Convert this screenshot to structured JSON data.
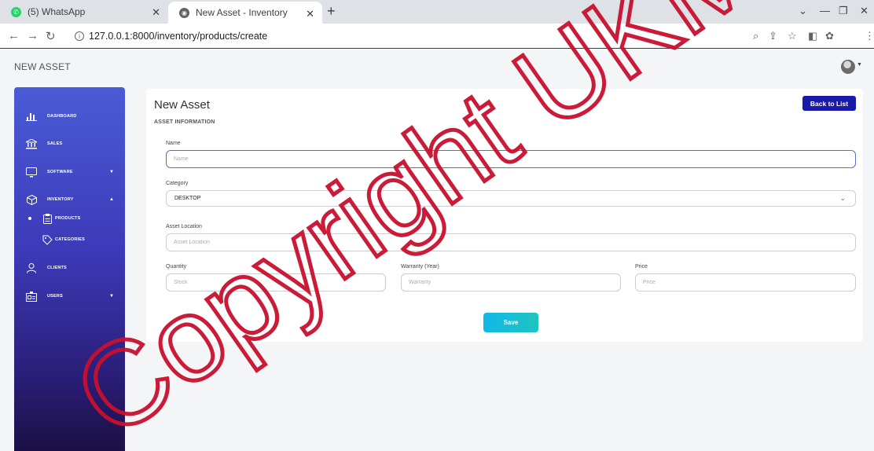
{
  "browser": {
    "tabs": [
      {
        "title": "(5) WhatsApp",
        "favicon_color": "#25d366"
      },
      {
        "title": "New Asset - Inventory",
        "favicon_color": "#5f6368"
      }
    ],
    "url": "127.0.0.1:8000/inventory/products/create"
  },
  "header": {
    "title": "NEW ASSET"
  },
  "sidebar": {
    "items": [
      {
        "label": "DASHBOARD",
        "icon": "bar-chart-icon"
      },
      {
        "label": "SALES",
        "icon": "bank-icon"
      },
      {
        "label": "SOFTWARE",
        "icon": "monitor-icon"
      },
      {
        "label": "INVENTORY",
        "icon": "box-icon"
      },
      {
        "label": "PRODUCTS",
        "icon": "clipboard-icon"
      },
      {
        "label": "CATEGORIES",
        "icon": "tag-icon"
      },
      {
        "label": "CLIENTS",
        "icon": "user-icon"
      },
      {
        "label": "USERS",
        "icon": "id-card-icon"
      }
    ]
  },
  "card": {
    "title": "New Asset",
    "section": "ASSET INFORMATION",
    "back_label": "Back to List"
  },
  "form": {
    "name": {
      "label": "Name",
      "placeholder": "Name",
      "value": ""
    },
    "category": {
      "label": "Category",
      "selected": "DESKTOP"
    },
    "location": {
      "label": "Asset Location",
      "placeholder": "Asset Location",
      "value": ""
    },
    "quantity": {
      "label": "Quantity",
      "placeholder": "Stock",
      "value": ""
    },
    "warranty": {
      "label": "Warranty (Year)",
      "placeholder": "Warranty",
      "value": ""
    },
    "price": {
      "label": "Price",
      "placeholder": "Price",
      "value": ""
    },
    "save_label": "Save"
  },
  "watermark": {
    "text": "Copyright UKM"
  },
  "colors": {
    "sidebar_top": "#4a5bd6",
    "sidebar_bottom": "#1b1045",
    "back_button": "#1a1aa8",
    "save_gradient": "#12b8e8"
  }
}
